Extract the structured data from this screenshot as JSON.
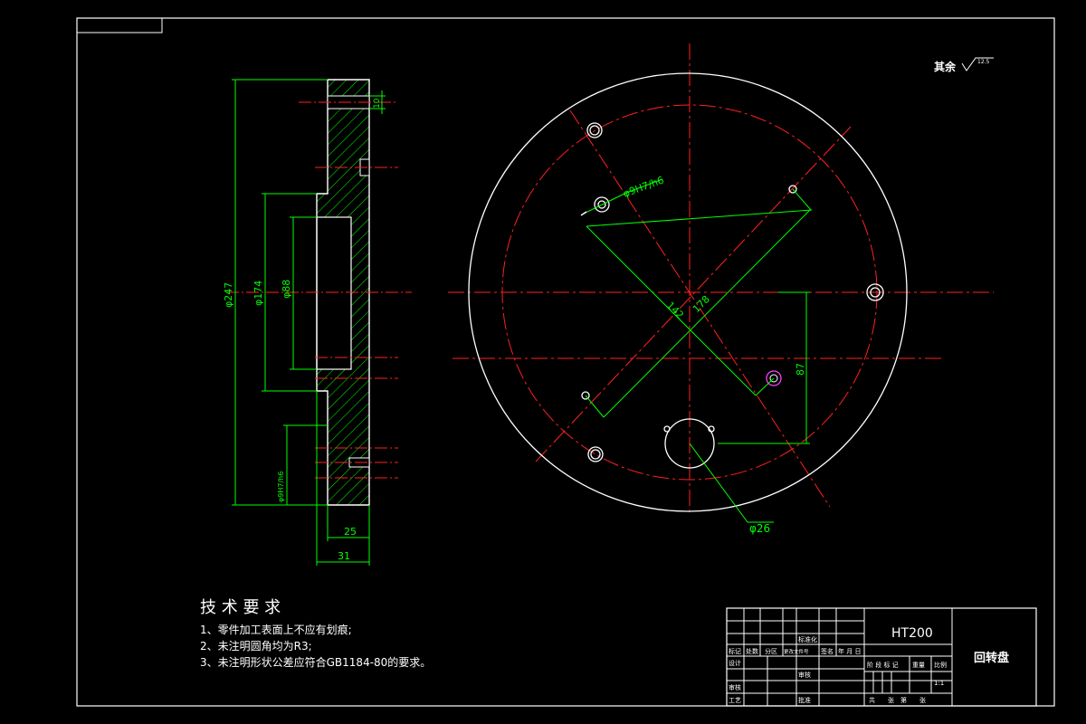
{
  "surface_note": "其余",
  "roughness_value": "12.5",
  "dims": {
    "d247": "φ247",
    "d174": "φ174",
    "d88": "φ88",
    "d9h7": "φ9H7/h6",
    "d9h7_left": "φ9H7/h6",
    "len25": "25",
    "len31": "31",
    "len10": "10",
    "d142": "142",
    "d178": "178",
    "len87": "87",
    "d26": "φ26"
  },
  "tech": {
    "title": "技 术 要 求",
    "items": [
      "1、零件加工表面上不应有划痕;",
      "2、未注明圆角均为R3;",
      "3、未注明形状公差应符合GB1184-80的要求。"
    ]
  },
  "title_block": {
    "material": "HT200",
    "part_name": "回转盘",
    "row_labels": [
      "标记",
      "处数",
      "分区",
      "更改文件号",
      "签名",
      "年 月 日"
    ],
    "design": "设计",
    "standardize": "标准化",
    "check": "审核",
    "process": "工艺",
    "review": "审核",
    "approve": "批准",
    "stage_mark": "阶 段 标 记",
    "weight": "重量",
    "scale": "比例",
    "scale_value": "1:1",
    "sheets": "共　　张　第　　张"
  }
}
